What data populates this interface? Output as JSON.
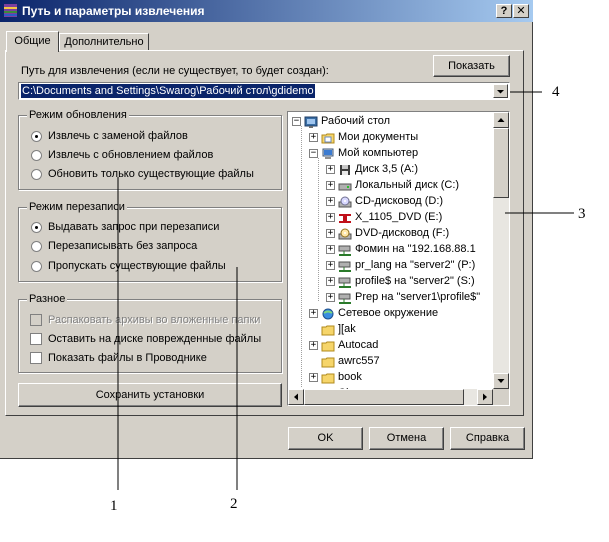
{
  "window": {
    "title": "Путь и параметры извлечения",
    "help_button": "?",
    "close_button": "✕"
  },
  "tabs": [
    {
      "label": "Общие",
      "active": true
    },
    {
      "label": "Дополнительно",
      "active": false
    }
  ],
  "path": {
    "label": "Путь для извлечения (если не существует, то будет создан):",
    "show_button": "Показать",
    "value": "C:\\Documents and Settings\\Swarog\\Рабочий стол\\gdidemo"
  },
  "update_mode": {
    "title": "Режим обновления",
    "options": [
      {
        "label": "Извлечь с заменой файлов",
        "selected": true
      },
      {
        "label": "Извлечь с обновлением файлов",
        "selected": false
      },
      {
        "label": "Обновить только существующие файлы",
        "selected": false
      }
    ]
  },
  "overwrite_mode": {
    "title": "Режим перезаписи",
    "options": [
      {
        "label": "Выдавать запрос при перезаписи",
        "selected": true
      },
      {
        "label": "Перезаписывать без запроса",
        "selected": false
      },
      {
        "label": "Пропускать существующие файлы",
        "selected": false
      }
    ]
  },
  "misc": {
    "title": "Разное",
    "options": [
      {
        "label": "Распаковать архивы во вложенные папки",
        "checked": false,
        "disabled": true
      },
      {
        "label": "Оставить на диске поврежденные файлы",
        "checked": false,
        "disabled": false
      },
      {
        "label": "Показать файлы в Проводнике",
        "checked": false,
        "disabled": false
      }
    ]
  },
  "save_button": "Сохранить установки",
  "tree": {
    "items": [
      {
        "label": "Рабочий стол",
        "icon": "desktop-icon",
        "expander": "−"
      },
      {
        "label": "Мои документы",
        "icon": "folder-docs-icon",
        "expander": "+"
      },
      {
        "label": "Мой компьютер",
        "icon": "computer-icon",
        "expander": "−"
      },
      {
        "label": "Диск 3,5 (A:)",
        "icon": "floppy-icon",
        "expander": "+"
      },
      {
        "label": "Локальный диск (C:)",
        "icon": "hard-drive-icon",
        "expander": "+"
      },
      {
        "label": "CD-дисковод (D:)",
        "icon": "cd-drive-icon",
        "expander": "+"
      },
      {
        "label": "X_1105_DVD (E:)",
        "icon": "dvd-label-icon",
        "expander": "+"
      },
      {
        "label": "DVD-дисковод (F:)",
        "icon": "dvd-drive-icon",
        "expander": "+"
      },
      {
        "label": "Фомин на \"192.168.88.1",
        "icon": "network-drive-icon",
        "expander": "+"
      },
      {
        "label": "pr_lang на \"server2\" (P:)",
        "icon": "network-drive-icon",
        "expander": "+"
      },
      {
        "label": "profile$ на \"server2\" (S:)",
        "icon": "network-drive-icon",
        "expander": "+"
      },
      {
        "label": "Prep на \"server1\\profile$\"",
        "icon": "network-drive-icon",
        "expander": "+"
      },
      {
        "label": "Сетевое окружение",
        "icon": "network-places-icon",
        "expander": "+"
      },
      {
        "label": "][ak",
        "icon": "folder-icon",
        "expander": ""
      },
      {
        "label": "Autocad",
        "icon": "folder-icon",
        "expander": "+"
      },
      {
        "label": "awrc557",
        "icon": "folder-icon",
        "expander": ""
      },
      {
        "label": "book",
        "icon": "folder-icon",
        "expander": "+"
      },
      {
        "label": "Ch...",
        "icon": "folder-icon",
        "expander": "+"
      }
    ]
  },
  "footer": {
    "ok": "OK",
    "cancel": "Отмена",
    "help": "Справка"
  },
  "callouts": [
    "1",
    "2",
    "3",
    "4"
  ],
  "colors": {
    "dialog_bg": "#d4d0c8",
    "title_start": "#0a246a",
    "title_end": "#a6caf0",
    "selection": "#0a246a",
    "folder": "#f6d56a"
  }
}
